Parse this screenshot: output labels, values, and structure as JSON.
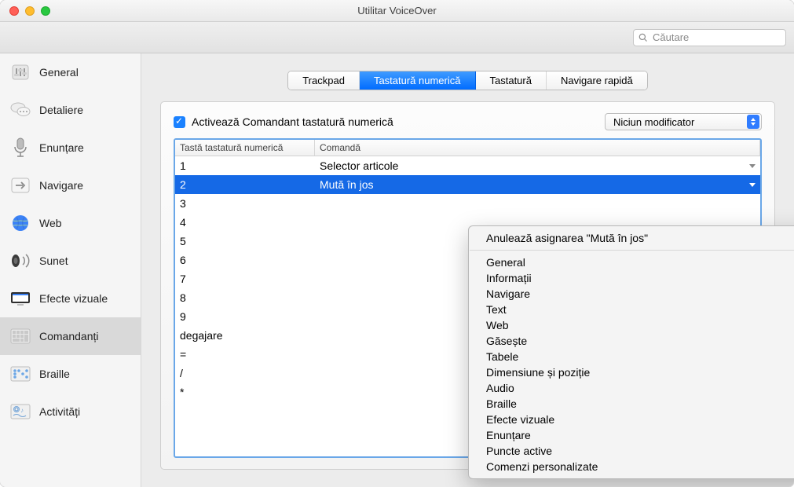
{
  "window": {
    "title": "Utilitar VoiceOver"
  },
  "toolbar": {
    "search_placeholder": "Căutare"
  },
  "sidebar": {
    "items": [
      {
        "label": "General"
      },
      {
        "label": "Detaliere"
      },
      {
        "label": "Enunțare"
      },
      {
        "label": "Navigare"
      },
      {
        "label": "Web"
      },
      {
        "label": "Sunet"
      },
      {
        "label": "Efecte vizuale"
      },
      {
        "label": "Comandanți"
      },
      {
        "label": "Braille"
      },
      {
        "label": "Activități"
      }
    ],
    "selected_index": 7
  },
  "tabs": {
    "items": [
      "Trackpad",
      "Tastatură numerică",
      "Tastatură",
      "Navigare rapidă"
    ],
    "active_index": 1
  },
  "panel": {
    "checkbox_label": "Activează Comandant tastatură numerică",
    "modifier_label": "Niciun modificator"
  },
  "table": {
    "headers": [
      "Tastă tastatură numerică",
      "Comandă"
    ],
    "rows": [
      {
        "key": "1",
        "command": "Selector articole"
      },
      {
        "key": "2",
        "command": "Mută în jos"
      },
      {
        "key": "3",
        "command": ""
      },
      {
        "key": "4",
        "command": ""
      },
      {
        "key": "5",
        "command": ""
      },
      {
        "key": "6",
        "command": ""
      },
      {
        "key": "7",
        "command": ""
      },
      {
        "key": "8",
        "command": ""
      },
      {
        "key": "9",
        "command": ""
      },
      {
        "key": "degajare",
        "command": ""
      },
      {
        "key": "=",
        "command": ""
      },
      {
        "key": "/",
        "command": ""
      },
      {
        "key": "*",
        "command": ""
      }
    ],
    "selected_index": 1
  },
  "context_menu": {
    "unassign": "Anulează asignarea \"Mută în jos\"",
    "items": [
      "General",
      "Informații",
      "Navigare",
      "Text",
      "Web",
      "Găsește",
      "Tabele",
      "Dimensiune și poziție",
      "Audio",
      "Braille",
      "Efecte vizuale",
      "Enunțare",
      "Puncte active",
      "Comenzi personalizate"
    ]
  }
}
